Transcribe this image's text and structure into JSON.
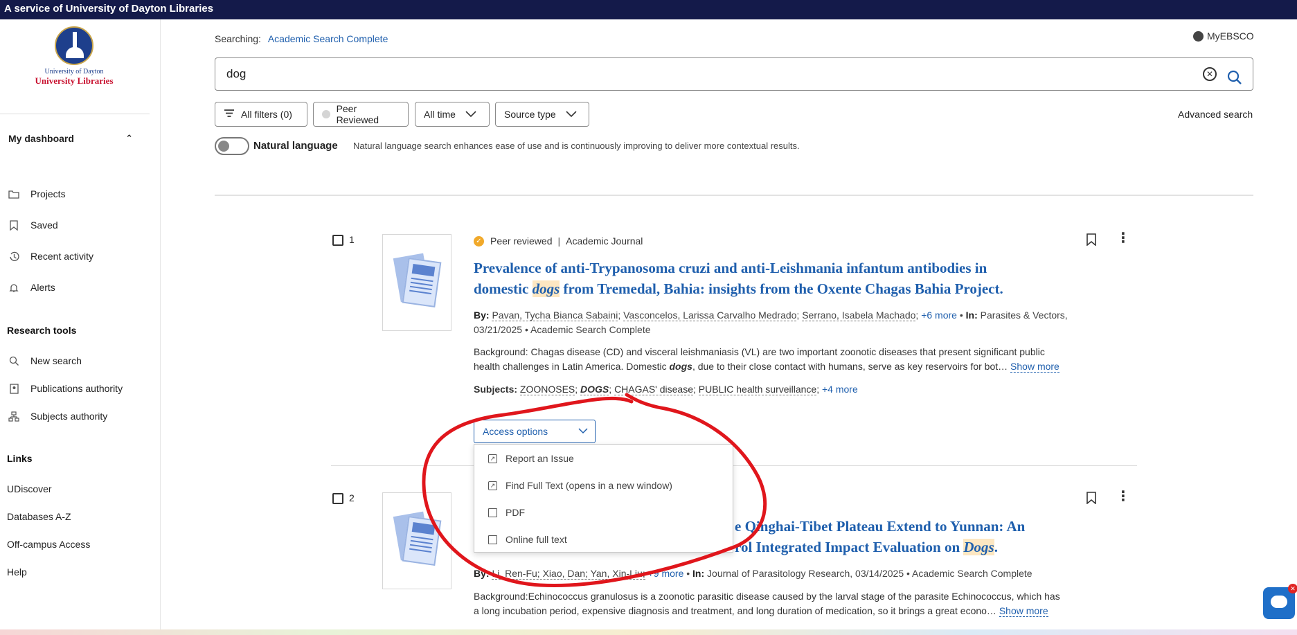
{
  "banner": {
    "text": "A service of University of Dayton Libraries"
  },
  "logo": {
    "line1": "University of Dayton",
    "line2": "University Libraries"
  },
  "sidebar": {
    "dashboard_label": "My dashboard",
    "dashboard_items": [
      {
        "label": "Projects",
        "icon": "folder-icon"
      },
      {
        "label": "Saved",
        "icon": "bookmark-icon"
      },
      {
        "label": "Recent activity",
        "icon": "history-icon"
      },
      {
        "label": "Alerts",
        "icon": "bell-icon"
      }
    ],
    "research_tools_label": "Research tools",
    "research_items": [
      {
        "label": "New search",
        "icon": "search-icon"
      },
      {
        "label": "Publications authority",
        "icon": "book-icon"
      },
      {
        "label": "Subjects authority",
        "icon": "hierarchy-icon"
      }
    ],
    "links_label": "Links",
    "links": [
      "UDiscover",
      "Databases A-Z",
      "Off-campus Access",
      "Help"
    ]
  },
  "search": {
    "searching_label": "Searching:",
    "database": "Academic Search Complete",
    "query": "dog",
    "myebsco": "MyEBSCO",
    "filters": {
      "all_filters": "All filters (0)",
      "peer_reviewed": "Peer Reviewed",
      "all_time": "All time",
      "source_type": "Source type"
    },
    "advanced": "Advanced search",
    "natural_language_label": "Natural language",
    "natural_language_desc": "Natural language search enhances ease of use and is continuously improving to deliver more contextual results."
  },
  "results": [
    {
      "number": "1",
      "peer": "Peer reviewed",
      "type": "Academic Journal",
      "title_a": "Prevalence of anti-Trypanosoma cruzi and anti-Leishmania infantum antibodies in",
      "title_b_pre": "domestic ",
      "title_b_hl": "dogs",
      "title_b_post": " from Tremedal, Bahia: insights from the Oxente Chagas Bahia Project.",
      "by_label": "By:",
      "authors": [
        "Pavan, Tycha Bianca Sabaini",
        "Vasconcelos, Larissa Carvalho Medrado",
        "Serrano, Isabela Machado"
      ],
      "more_authors": "+6 more",
      "in_label": "In:",
      "source": "Parasites & Vectors,",
      "date_db": "03/21/2025 • Academic Search Complete",
      "abstract_1": "Background: Chagas disease (CD) and visceral leishmaniasis (VL) are two important zoonotic diseases that present significant public",
      "abstract_2_pre": "health challenges in Latin America. Domestic ",
      "abstract_2_em": "dogs",
      "abstract_2_post": ", due to their close contact with humans, serve as key reservoirs for bot…",
      "show_more": "Show more",
      "subjects_label": "Subjects:",
      "subjects": [
        "ZOONOSES",
        "DOGS",
        "CHAGAS' disease",
        "PUBLIC health surveillance"
      ],
      "subjects_more": "+4 more",
      "access_label": "Access options",
      "access_menu": [
        "Report an Issue",
        "Find Full Text (opens in a new window)",
        "PDF",
        "Online full text"
      ]
    },
    {
      "number": "2",
      "title_a_visible": "e Qinghai-Tibet Plateau Extend to Yunnan: An",
      "title_b_visible": "rol Integrated Impact Evaluation on ",
      "title_b_hl": "Dogs",
      "title_b_post": ".",
      "by_label": "By:",
      "authors_visible": "Li, Ren-Fu; Xiao, Dan; Yan, Xin-Liu;",
      "more_authors": "+9 more",
      "in_label": "In:",
      "source_line": "Journal of Parasitology Research, 03/14/2025 • Academic Search Complete",
      "abstract_1": "Background:Echinococcus granulosus is a zoonotic parasitic disease caused by the larval stage of the parasite Echinococcus, which has",
      "abstract_2": "a long incubation period, expensive diagnosis and treatment, and long duration of medication, so it brings a great econo…",
      "show_more": "Show more"
    }
  ],
  "colors": {
    "banner": "#141a4a",
    "link": "#1f5fad",
    "highlight": "#fde7c2",
    "annotation": "#e0161c"
  }
}
